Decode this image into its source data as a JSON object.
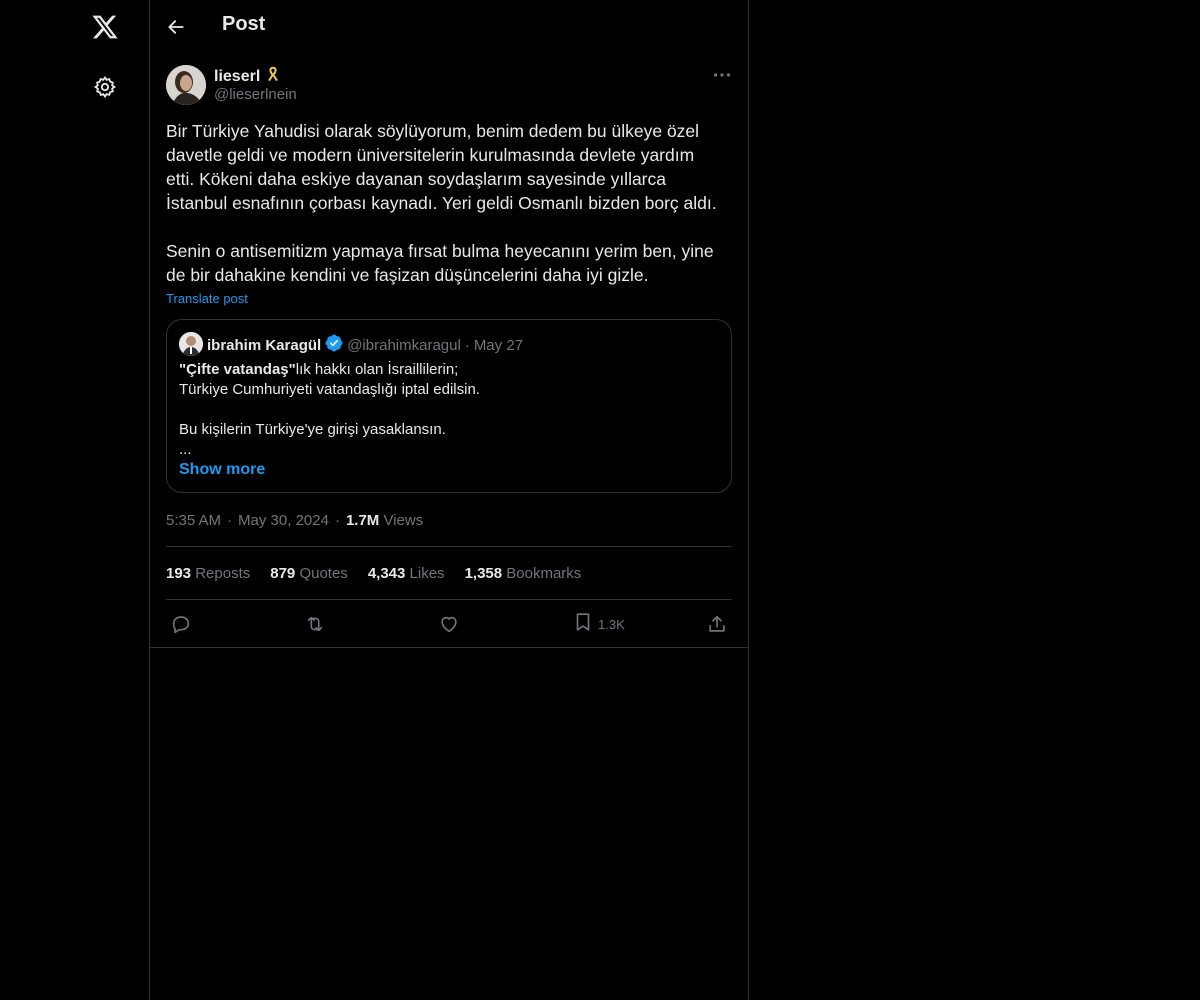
{
  "header": {
    "title": "Post"
  },
  "post": {
    "author": {
      "display_name": "lieserl",
      "handle": "@lieserlnein",
      "badge": "yellow-ribbon-emoji"
    },
    "body_paragraph_1": [
      "Bir Türkiye Yahudisi olarak söylüyorum, benim dedem bu ülkeye özel",
      "davetle geldi ve modern üniversitelerin kurulmasında devlete yardım",
      "etti. Kökeni daha eskiye dayanan soydaşlarım sayesinde yıllarca",
      "İstanbul esnafının çorbası kaynadı. Yeri geldi Osmanlı bizden borç aldı."
    ],
    "body_paragraph_2": [
      "Senin o antisemitizm yapmaya fırsat bulma heyecanını yerim ben, yine",
      "de bir dahakine kendini ve faşizan düşüncelerini daha iyi gizle."
    ],
    "translate_label": "Translate post",
    "time": "5:35 AM",
    "date": "May 30, 2024",
    "views_count": "1.7M",
    "views_label": "Views",
    "separator": "·"
  },
  "quote": {
    "display_name": "ibrahim Karagül",
    "handle": "@ibrahimkaragul",
    "separator": "·",
    "date": "May 27",
    "verified": true,
    "line1_bold": "\"Çifte vatandaş\"",
    "line1_rest": "lık hakkı olan İsraillilerin;",
    "line2": "Türkiye Cumhuriyeti vatandaşlığı iptal edilsin.",
    "line3": "Bu kişilerin Türkiye'ye girişi yasaklansın.",
    "line4": "...",
    "show_more": "Show more"
  },
  "stats": {
    "reposts": {
      "count": "193",
      "label": "Reposts"
    },
    "quotes": {
      "count": "879",
      "label": "Quotes"
    },
    "likes": {
      "count": "4,343",
      "label": "Likes"
    },
    "bookmarks": {
      "count": "1,358",
      "label": "Bookmarks"
    }
  },
  "actions": {
    "bookmark_count": "1.3K"
  },
  "colors": {
    "background": "#000000",
    "text_primary": "#e7e9ea",
    "text_secondary": "#71767b",
    "accent": "#1d9bf0",
    "border": "#2f3336"
  }
}
